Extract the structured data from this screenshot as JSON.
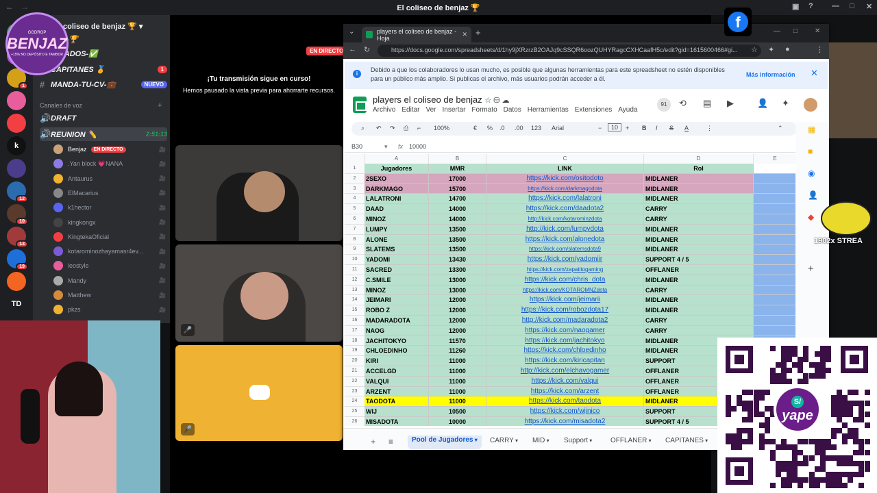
{
  "window_title": "El coliseo de benjaz 🏆",
  "server": {
    "name": "coliseo de benjaz 🏆"
  },
  "logo": {
    "line1": "GGDROP",
    "name": "BENJAZ",
    "line2": "+15% NO DEPÓSITO E TAMBOR"
  },
  "channels": [
    {
      "label": "PUS-🏆",
      "badge": ""
    },
    {
      "label": "ULTADOS-✅",
      "badge": ""
    },
    {
      "label": "CAPITANES 🏅",
      "badge": "1"
    },
    {
      "label": "MANDA-TU-CV-💼",
      "badge": "NUEVO"
    }
  ],
  "voice_category": "Canales de voz",
  "voice_channels": [
    {
      "label": "DRAFT"
    },
    {
      "label": "REUNION ✏️",
      "timer": "2:51:13"
    }
  ],
  "voice_users": [
    {
      "name": "Benjaz",
      "live": "EN DIRECTO",
      "color": "#c9a27a"
    },
    {
      "name": ".Yan block 💗NANA",
      "live": "",
      "color": "#8c7ae6"
    },
    {
      "name": "Antaurus",
      "live": "",
      "color": "#f0b232"
    },
    {
      "name": "ElMacarius",
      "live": "",
      "color": "#888888"
    },
    {
      "name": "k1hector",
      "live": "",
      "color": "#5865f2"
    },
    {
      "name": "kingkongx",
      "live": "",
      "color": "#444444"
    },
    {
      "name": "KingtekaOficial",
      "live": "",
      "color": "#f23f43"
    },
    {
      "name": "kotarominozhayamasr4ev...",
      "live": "",
      "color": "#7a5cd6"
    },
    {
      "name": "leostyle",
      "live": "",
      "color": "#e85d9c"
    },
    {
      "name": "Mandy",
      "live": "",
      "color": "#aaaaaa"
    },
    {
      "name": "Matthew",
      "live": "",
      "color": "#d68a3c"
    },
    {
      "name": "pkzs",
      "live": "",
      "color": "#f0b232"
    }
  ],
  "server_rail": [
    {
      "label": "",
      "badge": "1",
      "color": "#3ba55d"
    },
    {
      "label": "",
      "badge": "",
      "color": "#b34dd6"
    },
    {
      "label": "",
      "badge": "1",
      "color": "#d4a017"
    },
    {
      "label": "",
      "badge": "",
      "color": "#e85d9c"
    },
    {
      "label": "",
      "badge": "",
      "color": "#f23f43"
    },
    {
      "label": "k",
      "badge": "",
      "color": "#111111"
    },
    {
      "label": "",
      "badge": "",
      "color": "#4b3c8c"
    },
    {
      "label": "",
      "badge": "12",
      "color": "#2b6cb0"
    },
    {
      "label": "",
      "badge": "10",
      "color": "#5a3a2a"
    },
    {
      "label": "",
      "badge": "13",
      "color": "#a13a3a"
    },
    {
      "label": "",
      "badge": "19",
      "color": "#1e6fd9"
    },
    {
      "label": "",
      "badge": "",
      "color": "#f26522"
    },
    {
      "label": "TD",
      "badge": "",
      "color": "#1e1f22"
    }
  ],
  "live_badge": "EN DIRECTO",
  "stream_notice": {
    "title": "¡Tu transmisión sigue en curso!",
    "body": "Hemos pausado la vista previa para ahorrarte recursos."
  },
  "browser": {
    "tab_title": "players el coliseo de benjaz - Hoja",
    "url": "https://docs.google.com/spreadsheets/d/1hy9jXRzrzB2OAJq9cSSQR6oozQUHYRagcCXHCaafH5c/edit?gid=1615600466#gi...",
    "banner": "Debido a que los colaboradores lo usan mucho, es posible que algunas herramientas para este spreadsheet no estén disponibles para un público más amplio. Si publicas el archivo, más usuarios podrán acceder a él.",
    "banner_link": "Más información"
  },
  "sheet": {
    "title": "players el coliseo de benjaz",
    "menus": [
      "Archivo",
      "Editar",
      "Ver",
      "Insertar",
      "Formato",
      "Datos",
      "Herramientas",
      "Extensiones",
      "Ayuda"
    ],
    "zoom": "100%",
    "font": "Arial",
    "font_size": "10",
    "cell_ref": "B30",
    "formula": "10000",
    "col_letters": [
      "A",
      "B",
      "C",
      "D",
      "E"
    ],
    "headers": [
      "Jugadores",
      "MMR",
      "LINK",
      "Rol"
    ],
    "rows": [
      {
        "n": "2",
        "player": "2SEXO",
        "mmr": "17000",
        "link": "https://kick.com/ositodoto",
        "rol": "MIDLANER",
        "bg": "#d5a6bd"
      },
      {
        "n": "3",
        "player": "DARKMAGO",
        "mmr": "15700",
        "link": "https://kick.com/darkmagodota",
        "rol": "MIDLANER",
        "bg": "#d5a6bd"
      },
      {
        "n": "4",
        "player": "LALATRONI",
        "mmr": "14700",
        "link": "https://kick.com/lalatroni",
        "rol": "MIDLANER",
        "bg": "#b7e1cd"
      },
      {
        "n": "5",
        "player": "DAAD",
        "mmr": "14000",
        "link": "https://kick.com/daadota2",
        "rol": "CARRY",
        "bg": "#b7e1cd"
      },
      {
        "n": "6",
        "player": "MINOZ",
        "mmr": "14000",
        "link": "http://kick.com/kotarominzdota",
        "rol": "CARRY",
        "bg": "#b7e1cd"
      },
      {
        "n": "7",
        "player": "LUMPY",
        "mmr": "13500",
        "link": "http://kick.com/lumpydota",
        "rol": "MIDLANER",
        "bg": "#b7e1cd"
      },
      {
        "n": "8",
        "player": "ALONE",
        "mmr": "13500",
        "link": "https://kick.com/alonedota",
        "rol": "MIDLANER",
        "bg": "#b7e1cd"
      },
      {
        "n": "9",
        "player": "SLATEMS",
        "mmr": "13500",
        "link": "https://kick.com/slatemsdota9",
        "rol": "MIDLANER",
        "bg": "#b7e1cd"
      },
      {
        "n": "10",
        "player": "YADOMI",
        "mmr": "13430",
        "link": "https://kick.com/yadomiir",
        "rol": "SUPPORT 4 / 5",
        "bg": "#b7e1cd"
      },
      {
        "n": "11",
        "player": "SACRED",
        "mmr": "13300",
        "link": "https://kick.com/zapatitogaming",
        "rol": "OFFLANER",
        "bg": "#b7e1cd"
      },
      {
        "n": "12",
        "player": "C.SMILE",
        "mmr": "13000",
        "link": "https://kick.com/chris_dota",
        "rol": "MIDLANER",
        "bg": "#b7e1cd"
      },
      {
        "n": "13",
        "player": "MINOZ",
        "mmr": "13000",
        "link": "https://kick.com/KOTAROMNZdota",
        "rol": "CARRY",
        "bg": "#b7e1cd"
      },
      {
        "n": "14",
        "player": "JEIMARI",
        "mmr": "12000",
        "link": "https://kick.com/jeimarii",
        "rol": "MIDLANER",
        "bg": "#b7e1cd"
      },
      {
        "n": "15",
        "player": "ROBO Z",
        "mmr": "12000",
        "link": "https://kick.com/robozdota17",
        "rol": "MIDLANER",
        "bg": "#b7e1cd"
      },
      {
        "n": "16",
        "player": "MADARADOTA",
        "mmr": "12000",
        "link": "http://kick.com/madaradota2",
        "rol": "CARRY",
        "bg": "#b7e1cd"
      },
      {
        "n": "17",
        "player": "NAOG",
        "mmr": "12000",
        "link": "https://kick.com/naogamer",
        "rol": "CARRY",
        "bg": "#b7e1cd"
      },
      {
        "n": "18",
        "player": "JACHITOKYO",
        "mmr": "11570",
        "link": "https://kick.com/jachitokyo",
        "rol": "MIDLANER",
        "bg": "#b7e1cd"
      },
      {
        "n": "19",
        "player": "CHLOEDINHO",
        "mmr": "11260",
        "link": "https://kick.com/chloedinho",
        "rol": "MIDLANER",
        "bg": "#b7e1cd"
      },
      {
        "n": "20",
        "player": "KIRI",
        "mmr": "11000",
        "link": "https://kick.com/kiricapitan",
        "rol": "SUPPORT",
        "bg": "#b7e1cd"
      },
      {
        "n": "21",
        "player": "ACCELGD",
        "mmr": "11000",
        "link": "http://kick.com/elchavogamer",
        "rol": "OFFLANER",
        "bg": "#b7e1cd"
      },
      {
        "n": "22",
        "player": "VALQUI",
        "mmr": "11000",
        "link": "https://kick.com/valqui",
        "rol": "OFFLANER",
        "bg": "#b7e1cd"
      },
      {
        "n": "23",
        "player": "ARZENT",
        "mmr": "11000",
        "link": "https://kick.com/arzent",
        "rol": "OFFLANER",
        "bg": "#b7e1cd"
      },
      {
        "n": "24",
        "player": "TAODOTA",
        "mmr": "11000",
        "link": "https://kick.com/taodota",
        "rol": "MIDLANER",
        "bg": "#ffff00"
      },
      {
        "n": "25",
        "player": "WIJ",
        "mmr": "10500",
        "link": "https://kick.com/wijnico",
        "rol": "SUPPORT",
        "bg": "#b7e1cd"
      },
      {
        "n": "26",
        "player": "MISADOTA",
        "mmr": "10000",
        "link": "https://kick.com/misadota2",
        "rol": "SUPPORT 4 / 5",
        "bg": "#b7e1cd"
      }
    ],
    "tabs": [
      "Pool de Jugadores",
      "CARRY",
      "MID",
      "Support",
      "OFFLANER",
      "CAPITANES"
    ],
    "avatar_count": "91"
  },
  "overlay": {
    "stream_text": "1902x STREA",
    "qr_brand": "yape",
    "qr_currency": "S/"
  },
  "colors": {
    "discord_red": "#f23f43",
    "discord_blurple": "#5865f2",
    "sheets_green": "#0f9d58",
    "link_blue": "#1155cc"
  }
}
